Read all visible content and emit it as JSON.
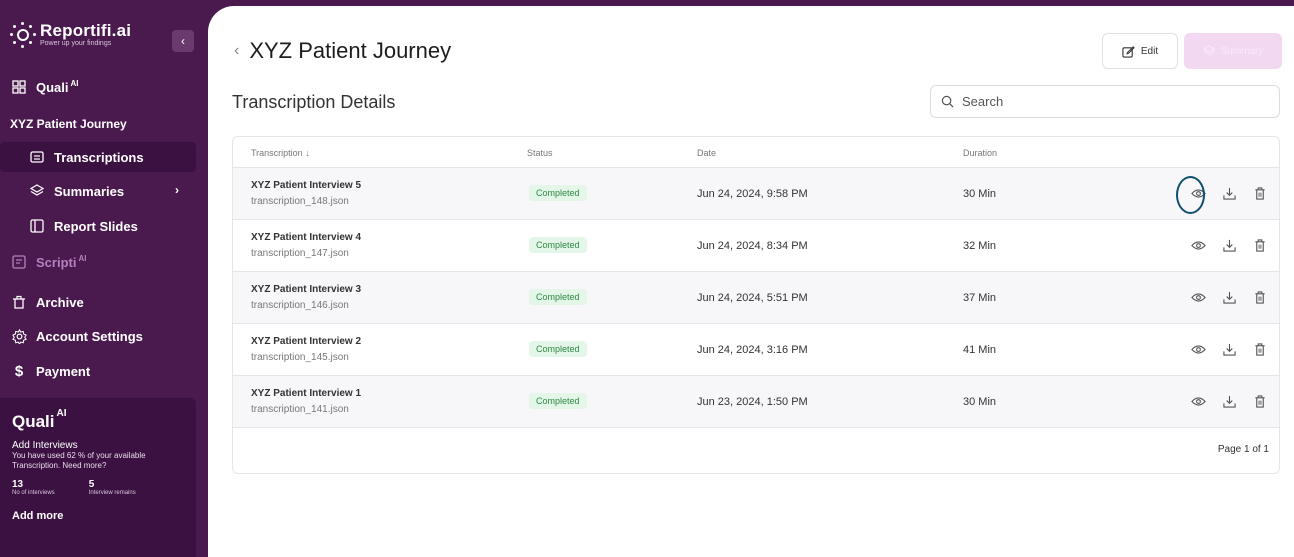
{
  "brand": {
    "name": "Reportifi.ai",
    "tagline": "Power up your findings"
  },
  "sidebar": {
    "quali_label": "Quali",
    "quali_sup": "AI",
    "project": "XYZ Patient Journey",
    "items": [
      {
        "label": "Transcriptions",
        "icon": "folder-icon"
      },
      {
        "label": "Summaries",
        "icon": "layers-icon"
      },
      {
        "label": "Report Slides",
        "icon": "slides-icon"
      }
    ],
    "scripti_label": "Scripti",
    "scripti_sup": "AI",
    "archive": "Archive",
    "account_settings": "Account Settings",
    "payment": "Payment",
    "promo": {
      "title": "Quali",
      "title_sup": "AI",
      "heading": "Add Interviews",
      "text": "You have used 62 % of your available Transcription. Need more?",
      "interviews_count": "13",
      "interviews_label": "No of interviews",
      "remaining_count": "5",
      "remaining_label": "Interview remains",
      "add_more": "Add more"
    }
  },
  "header": {
    "title": "XYZ Patient Journey",
    "edit_label": "Edit",
    "summary_label": "Summary"
  },
  "section": {
    "title": "Transcription Details"
  },
  "search": {
    "placeholder": "Search"
  },
  "table": {
    "columns": [
      "Transcription",
      "Status",
      "Date",
      "Duration"
    ],
    "rows": [
      {
        "name": "XYZ Patient Interview 5",
        "file": "transcription_148.json",
        "status": "Completed",
        "date": "Jun 24, 2024, 9:58 PM",
        "duration": "30 Min"
      },
      {
        "name": "XYZ Patient Interview 4",
        "file": "transcription_147.json",
        "status": "Completed",
        "date": "Jun 24, 2024, 8:34 PM",
        "duration": "32 Min"
      },
      {
        "name": "XYZ Patient Interview 3",
        "file": "transcription_146.json",
        "status": "Completed",
        "date": "Jun 24, 2024, 5:51 PM",
        "duration": "37 Min"
      },
      {
        "name": "XYZ Patient Interview 2",
        "file": "transcription_145.json",
        "status": "Completed",
        "date": "Jun 24, 2024, 3:16 PM",
        "duration": "41 Min"
      },
      {
        "name": "XYZ Patient Interview 1",
        "file": "transcription_141.json",
        "status": "Completed",
        "date": "Jun 23, 2024, 1:50 PM",
        "duration": "30 Min"
      }
    ],
    "pagination": "Page 1 of 1"
  },
  "colors": {
    "sidebar": "#4a1a4e",
    "accent": "#f2d9f1",
    "status_bg": "#e4f6e8",
    "status_text": "#2c8a44",
    "highlight": "#0f4e6e"
  }
}
